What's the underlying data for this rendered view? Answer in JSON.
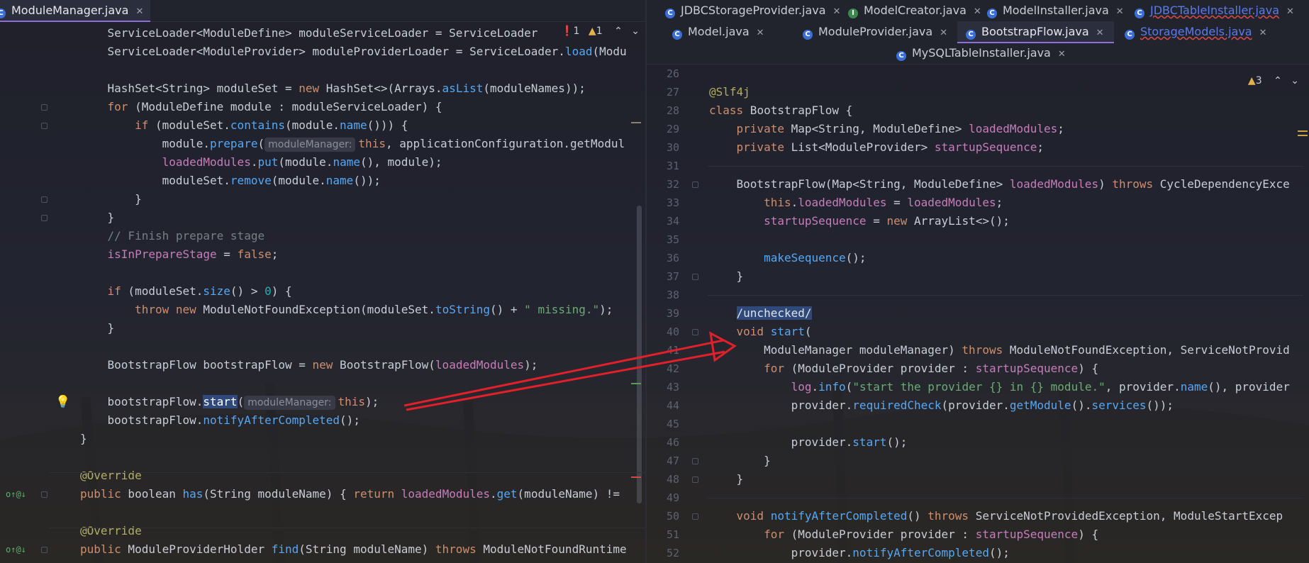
{
  "left": {
    "tab": {
      "label": "ModuleManager.java"
    },
    "indicators": {
      "errors": "1",
      "warnings": "1"
    },
    "lines": [
      {
        "pre": "    ServiceLoader<ModuleDefine> moduleServiceLoader = ServiceLoader",
        "hint": "",
        "post": ""
      },
      {
        "pre": "    ServiceLoader<ModuleProvider> moduleProviderLoader = ServiceLoader.load(Modu",
        "hint": "",
        "post": ""
      },
      {
        "pre": "",
        "hint": "",
        "post": ""
      },
      {
        "pre": "    HashSet<String> moduleSet = new HashSet<>(Arrays.asList(moduleNames));",
        "hint": "",
        "post": ""
      },
      {
        "pre": "    for (ModuleDefine module : moduleServiceLoader) {",
        "hint": "",
        "post": ""
      },
      {
        "pre": "        if (moduleSet.contains(module.name())) {",
        "hint": "",
        "post": ""
      },
      {
        "pre": "            module.prepare(",
        "hint": "moduleManager:",
        "post": "this, applicationConfiguration.getModul"
      },
      {
        "pre": "            loadedModules.put(module.name(), module);",
        "hint": "",
        "post": ""
      },
      {
        "pre": "            moduleSet.remove(module.name());",
        "hint": "",
        "post": ""
      },
      {
        "pre": "        }",
        "hint": "",
        "post": ""
      },
      {
        "pre": "    }",
        "hint": "",
        "post": ""
      },
      {
        "pre": "    // Finish prepare stage",
        "hint": "",
        "post": ""
      },
      {
        "pre": "    isInPrepareStage = false;",
        "hint": "",
        "post": ""
      },
      {
        "pre": "",
        "hint": "",
        "post": ""
      },
      {
        "pre": "    if (moduleSet.size() > 0) {",
        "hint": "",
        "post": ""
      },
      {
        "pre": "        throw new ModuleNotFoundException(moduleSet.toString() + \" missing.\");",
        "hint": "",
        "post": ""
      },
      {
        "pre": "    }",
        "hint": "",
        "post": ""
      },
      {
        "pre": "",
        "hint": "",
        "post": ""
      },
      {
        "pre": "    BootstrapFlow bootstrapFlow = new BootstrapFlow(loadedModules);",
        "hint": "",
        "post": ""
      },
      {
        "pre": "",
        "hint": "",
        "post": ""
      },
      {
        "pre": "    bootstrapFlow.",
        "sel": "start",
        "hint": "moduleManager:",
        "post": "this);"
      },
      {
        "pre": "    bootstrapFlow.notifyAfterCompleted();",
        "hint": "",
        "post": ""
      },
      {
        "pre": "}",
        "hint": "",
        "post": ""
      },
      {
        "pre": "",
        "hint": "",
        "post": ""
      },
      {
        "pre": "@Override",
        "hint": "",
        "post": ""
      },
      {
        "pre": "public boolean has(String moduleName) { return loadedModules.get(moduleName) != ",
        "hint": "",
        "post": ""
      },
      {
        "pre": "",
        "hint": "",
        "post": ""
      },
      {
        "pre": "@Override",
        "hint": "",
        "post": ""
      },
      {
        "pre": "public ModuleProviderHolder find(String moduleName) throws ModuleNotFoundRuntime",
        "hint": "",
        "post": ""
      }
    ]
  },
  "right": {
    "tabs_row1": [
      {
        "label": "JDBCStorageProvider.java",
        "icon": "C"
      },
      {
        "label": "ModelCreator.java",
        "icon": "I"
      },
      {
        "label": "ModelInstaller.java",
        "icon": "C"
      },
      {
        "label": "JDBCTableInstaller.java",
        "icon": "C"
      }
    ],
    "tabs_row2": [
      {
        "label": "Model.java",
        "icon": "C"
      },
      {
        "label": "ModuleProvider.java",
        "icon": "C"
      },
      {
        "label": "BootstrapFlow.java",
        "icon": "C"
      },
      {
        "label": "StorageModels.java",
        "icon": "C"
      }
    ],
    "tabs_row3": [
      {
        "label": "MySQLTableInstaller.java",
        "icon": "C"
      }
    ],
    "indicators": {
      "warnings": "3"
    },
    "lines": [
      {
        "num": "26",
        "text": ""
      },
      {
        "num": "27",
        "text": "@Slf4j"
      },
      {
        "num": "28",
        "text": "class BootstrapFlow {"
      },
      {
        "num": "29",
        "text": "    private Map<String, ModuleDefine> loadedModules;"
      },
      {
        "num": "30",
        "text": "    private List<ModuleProvider> startupSequence;"
      },
      {
        "num": "31",
        "text": ""
      },
      {
        "num": "32",
        "text": "    BootstrapFlow(Map<String, ModuleDefine> loadedModules) throws CycleDependencyExce"
      },
      {
        "num": "33",
        "text": "        this.loadedModules = loadedModules;"
      },
      {
        "num": "34",
        "text": "        startupSequence = new ArrayList<>();"
      },
      {
        "num": "35",
        "text": ""
      },
      {
        "num": "36",
        "text": "        makeSequence();"
      },
      {
        "num": "37",
        "text": "    }"
      },
      {
        "num": "38",
        "text": ""
      },
      {
        "num": "39",
        "text": "    /unchecked/"
      },
      {
        "num": "40",
        "text": "    void start("
      },
      {
        "num": "41",
        "text": "        ModuleManager moduleManager) throws ModuleNotFoundException, ServiceNotProvid"
      },
      {
        "num": "42",
        "text": "        for (ModuleProvider provider : startupSequence) {"
      },
      {
        "num": "43",
        "text": "            log.info(\"start the provider {} in {} module.\", provider.name(), provider"
      },
      {
        "num": "44",
        "text": "            provider.requiredCheck(provider.getModule().services());"
      },
      {
        "num": "45",
        "text": ""
      },
      {
        "num": "46",
        "text": "            provider.start();"
      },
      {
        "num": "47",
        "text": "        }"
      },
      {
        "num": "48",
        "text": "    }"
      },
      {
        "num": "49",
        "text": ""
      },
      {
        "num": "50",
        "text": "    void notifyAfterCompleted() throws ServiceNotProvidedException, ModuleStartExcep"
      },
      {
        "num": "51",
        "text": "        for (ModuleProvider provider : startupSequence) {"
      },
      {
        "num": "52",
        "text": "            provider.notifyAfterCompleted();"
      }
    ]
  },
  "colors": {
    "keyword": "#cf8e6d",
    "field": "#c77dbb",
    "method": "#56a8f5",
    "string": "#6aab73",
    "annotation": "#b3ae60",
    "comment": "#7a7e85",
    "arrow": "#e0202a"
  }
}
